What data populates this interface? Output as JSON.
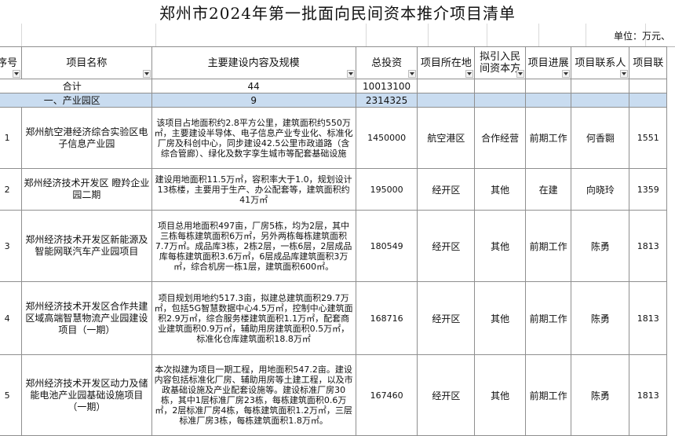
{
  "title": "郑州市2024年第一批面向民间资本推介项目清单",
  "unit": "单位：万元、",
  "headers": {
    "seq": "序号",
    "name": "项目名称",
    "content": "主要建设内容及规模",
    "investment": "总投资",
    "location": "项目所在地",
    "mode": "拟引入民间资本方",
    "progress": "项目进展",
    "contact": "项目联系人",
    "phone": "项目联"
  },
  "total": {
    "label": "合计",
    "count": "44",
    "investment": "10013100"
  },
  "section": {
    "label": "一、产业园区",
    "count": "9",
    "investment": "2314325"
  },
  "rows": [
    {
      "seq": "1",
      "name": "郑州航空港经济综合实验区电子信息产业园",
      "content": "该项目占地面积约2.8平方公里，建筑面积约550万㎡，主要建设半导体、电子信息产业专业化、标准化厂房及科创中心，同步建设42.5公里市政道路（含综合管廊）、绿化及数字孪生城市等配套基础设施",
      "investment": "1450000",
      "location": "航空港区",
      "mode": "合作经营",
      "progress": "前期工作",
      "contact": "何香翾",
      "phone": "1551"
    },
    {
      "seq": "2",
      "name": "郑州经济技术开发区 瞪羚企业园二期",
      "content": "建设用地面积11.5万㎡，容积率大于1.0，规划设计13栋楼，主要用于生产、办公配套等，建筑面积约41万㎡",
      "investment": "195000",
      "location": "经开区",
      "mode": "其他",
      "progress": "在建",
      "contact": "向晓玲",
      "phone": "1359"
    },
    {
      "seq": "3",
      "name": "郑州经济技术开发区新能源及智能网联汽车产业园项目",
      "content": "项目总用地面积497亩，厂房5栋，均为2层，其中三栋每栋建筑面积6万㎡，另外两栋每栋建筑面积7.7万㎡。成品库3栋，2栋2层，一栋6层，2层成品库每栋建筑面积3.6万㎡，6层成品库建筑面积3万㎡，综合机房一栋1层，建筑面积600㎡。",
      "investment": "180549",
      "location": "经开区",
      "mode": "其他",
      "progress": "前期工作",
      "contact": "陈勇",
      "phone": "1813"
    },
    {
      "seq": "4",
      "name": "郑州经济技术开发区合作共建区域高端智慧物流产业园建设项目（一期）",
      "content": "项目规划用地约517.3亩，拟建总建筑面积29.7万㎡，包括5G智慧数据中心4.5万㎡，控制中心建筑面积2.9万㎡，综合服务楼建筑面积1.1万㎡，配套商业建筑面积0.9万㎡，辅助用房建筑面积0.5万㎡，标准化仓库建筑面积18.8万㎡",
      "investment": "168716",
      "location": "经开区",
      "mode": "其他",
      "progress": "前期工作",
      "contact": "陈勇",
      "phone": "1813"
    },
    {
      "seq": "5",
      "name": "郑州经济技术开发区动力及储能电池产业园基础设施项目（一期）",
      "content": "本次拟建为项目一期工程，用地面积547.2亩。建设内容包括标准化厂房、辅助用房等土建工程，以及市政基础设施及产业配套设施等。建设标准厂房30栋，其中1层标准厂房23栋，每栋建筑面积0.6万㎡，2层标准厂房4栋，每栋建筑面积1.2万㎡，三层标准厂房3栋，每栋建筑面积1.8万㎡。",
      "investment": "167460",
      "location": "经开区",
      "mode": "其他",
      "progress": "前期工作",
      "contact": "陈勇",
      "phone": "1813"
    }
  ]
}
